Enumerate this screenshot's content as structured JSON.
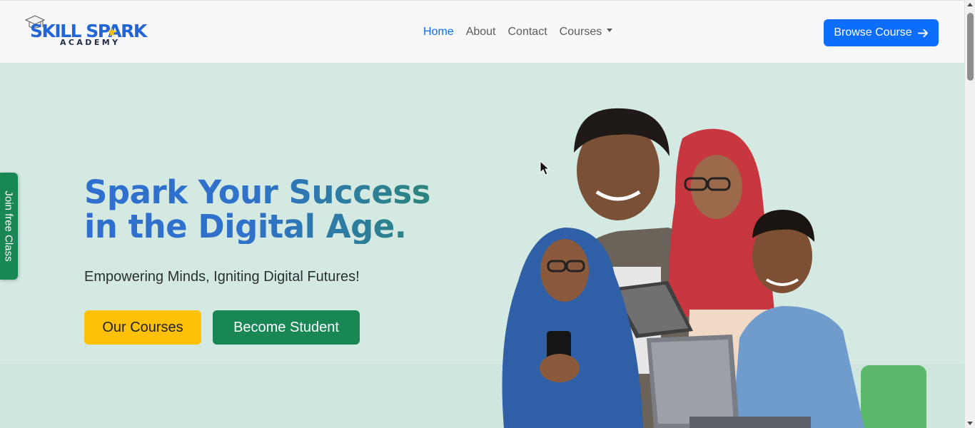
{
  "brand": {
    "logo_main": "SKILL SPARK",
    "logo_sub": "ACADEMY",
    "logo_icon": "graduation-cap-icon",
    "colors": {
      "primary": "#0d6efd",
      "logo_blue": "#2165d6",
      "warning": "#ffc107",
      "success": "#198754",
      "hero_bg": "#d3e9e2"
    }
  },
  "nav": {
    "links": [
      {
        "label": "Home",
        "active": true
      },
      {
        "label": "About",
        "active": false
      },
      {
        "label": "Contact",
        "active": false
      },
      {
        "label": "Courses",
        "active": false,
        "dropdown": true
      }
    ],
    "cta_label": "Browse Course",
    "cta_icon": "arrow-right-icon"
  },
  "hero": {
    "title": "Spark Your Success in the Digital Age.",
    "subtitle": "Empowering Minds, Igniting Digital Futures!",
    "primary_button": "Our Courses",
    "secondary_button": "Become Student",
    "image": "students-group-photo"
  },
  "side_tab": {
    "label": "Join free Class"
  }
}
